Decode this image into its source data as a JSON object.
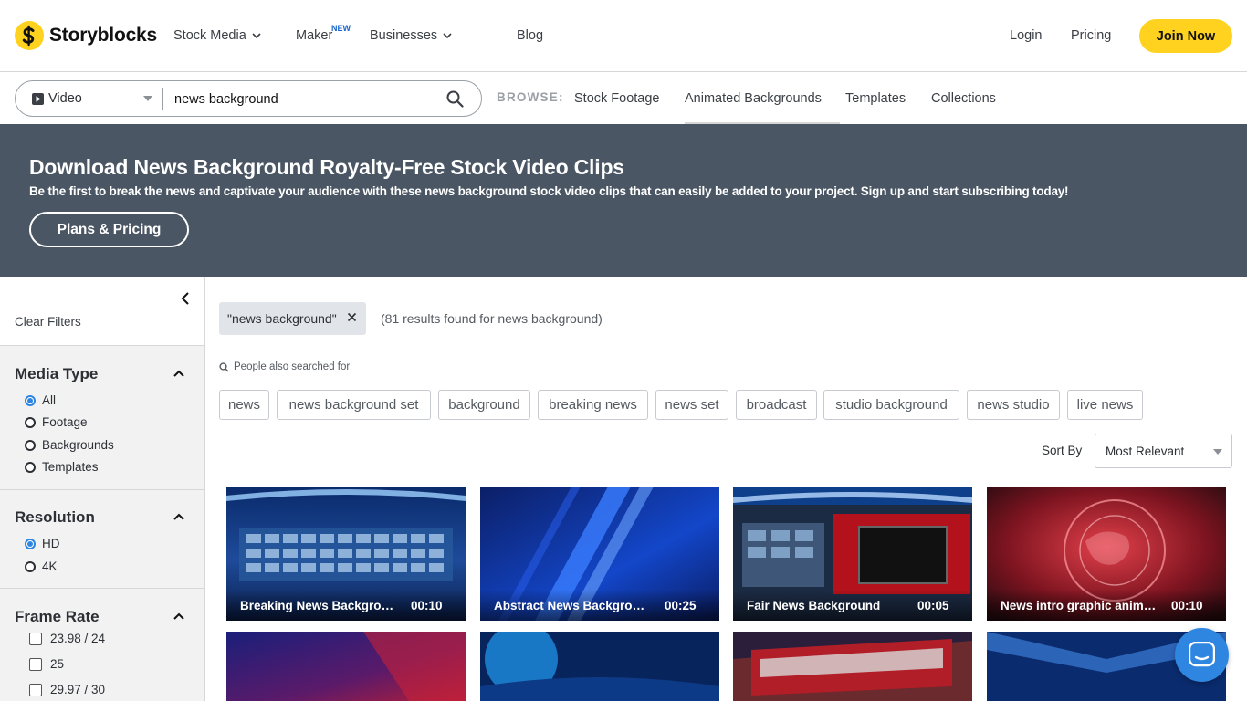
{
  "brand": {
    "name": "Storyblocks",
    "accent": "#ffd21f"
  },
  "nav": {
    "stock_media": "Stock Media",
    "maker": "Maker",
    "maker_badge": "NEW",
    "businesses": "Businesses",
    "blog": "Blog",
    "login": "Login",
    "pricing": "Pricing",
    "join": "Join Now"
  },
  "search": {
    "media_type": "Video",
    "query": "news background",
    "browse_label": "BROWSE:",
    "browse_links": [
      "Stock Footage",
      "Animated Backgrounds",
      "Templates",
      "Collections"
    ]
  },
  "banner": {
    "title": "Download News Background Royalty-Free Stock Video Clips",
    "subtitle": "Be the first to break the news and captivate your audience with these news background stock video clips that can easily be added to your project. Sign up and start subscribing today!",
    "cta": "Plans & Pricing",
    "bg_color": "#4a5663"
  },
  "filters": {
    "clear": "Clear Filters",
    "media_type": {
      "title": "Media Type",
      "options": [
        "All",
        "Footage",
        "Backgrounds",
        "Templates"
      ],
      "selected": "All"
    },
    "resolution": {
      "title": "Resolution",
      "options": [
        "HD",
        "4K"
      ],
      "selected": "HD"
    },
    "frame_rate": {
      "title": "Frame Rate",
      "options": [
        "23.98 / 24",
        "25",
        "29.97 / 30"
      ]
    }
  },
  "results": {
    "query_chip": "\"news background\"",
    "count_text": "(81 results found for news background)",
    "also_searched_label": "People also searched for",
    "related_tags": [
      "news",
      "news background set",
      "background",
      "breaking news",
      "news set",
      "broadcast",
      "studio background",
      "news studio",
      "live news"
    ],
    "sort_label": "Sort By",
    "sort_value": "Most Relevant",
    "clips": [
      {
        "title": "Breaking News Background - Virtual Studio",
        "duration": "00:10"
      },
      {
        "title": "Abstract News Background",
        "duration": "00:25"
      },
      {
        "title": "Fair News Background",
        "duration": "00:05"
      },
      {
        "title": "News intro graphic animation",
        "duration": "00:10"
      }
    ]
  }
}
